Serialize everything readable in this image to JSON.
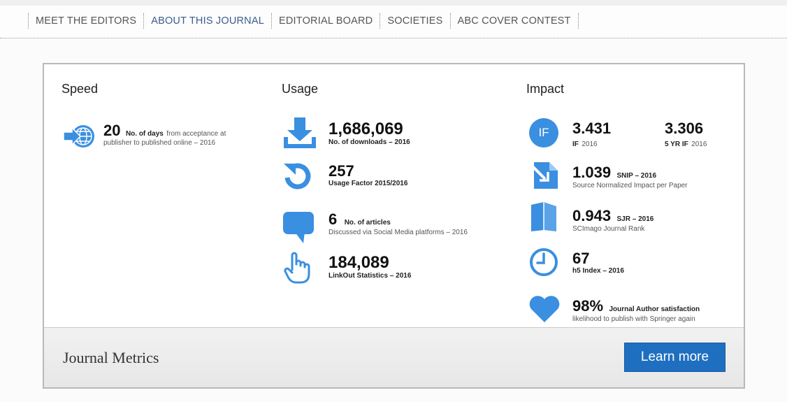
{
  "nav": {
    "items": [
      {
        "label": "MEET THE EDITORS"
      },
      {
        "label": "ABOUT THIS JOURNAL"
      },
      {
        "label": "EDITORIAL BOARD"
      },
      {
        "label": "SOCIETIES"
      },
      {
        "label": "ABC COVER CONTEST"
      }
    ],
    "active_index": 1
  },
  "colors": {
    "icon_blue": "#3a8fe0",
    "button_blue": "#1f6fc1",
    "nav_active": "#3b5c8c"
  },
  "speed": {
    "heading": "Speed",
    "icon": "globe-arrow-icon",
    "value": "20",
    "label_bold": "No. of days",
    "label_rest": "from acceptance at",
    "label_line2": "publisher to published online – 2016"
  },
  "usage": {
    "heading": "Usage",
    "items": [
      {
        "icon": "download-icon",
        "value": "1,686,069",
        "label": "No. of downloads – 2016"
      },
      {
        "icon": "refresh-icon",
        "value": "257",
        "label": "Usage Factor 2015/2016"
      },
      {
        "icon": "speech-bubble-icon",
        "value": "6",
        "label_inline": "No. of articles",
        "label2": "Discussed via Social Media platforms – 2016"
      },
      {
        "icon": "pointer-hand-icon",
        "value": "184,089",
        "label": "LinkOut Statistics – 2016"
      }
    ]
  },
  "impact": {
    "heading": "Impact",
    "if_icon_text": "IF",
    "if": {
      "value": "3.431",
      "label_bold": "IF",
      "label_year": "2016"
    },
    "five_yr_if": {
      "value": "3.306",
      "label_bold": "5 YR IF",
      "label_year": "2016"
    },
    "snip": {
      "icon": "snip-icon",
      "value": "1.039",
      "inline": "SNIP – 2016",
      "label": "Source Normalized Impact per Paper"
    },
    "sjr": {
      "icon": "book-icon",
      "value": "0.943",
      "inline": "SJR – 2016",
      "label": "SCImago Journal Rank"
    },
    "h5": {
      "icon": "clock-icon",
      "value": "67",
      "label": "h5 Index – 2016"
    },
    "satisfaction": {
      "icon": "heart-icon",
      "value": "98%",
      "inline": "Journal Author satisfaction",
      "label": "likelihood to publish with Springer again"
    }
  },
  "footer": {
    "title": "Journal Metrics",
    "button": "Learn more"
  }
}
